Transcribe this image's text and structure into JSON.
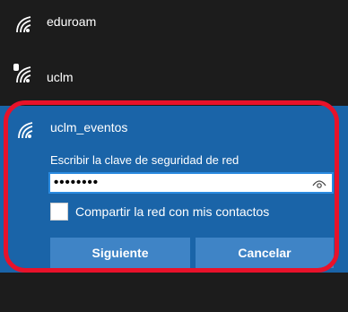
{
  "networks": [
    {
      "name": "eduroam",
      "icon": "wifi-signal-icon"
    },
    {
      "name": "uclm",
      "icon": "wifi-secured-icon"
    }
  ],
  "selected_network": {
    "name": "uclm_eventos",
    "icon": "wifi-signal-icon",
    "prompt": "Escribir la clave de seguridad de red",
    "password_value": "••••••••",
    "share_label": "Compartir la red con mis contactos",
    "share_checked": false,
    "next_label": "Siguiente",
    "cancel_label": "Cancelar"
  },
  "colors": {
    "panel_bg": "#1c1c1c",
    "selected_bg": "#1a64a8",
    "button_bg": "#3f84c6",
    "highlight": "#e8122a"
  }
}
